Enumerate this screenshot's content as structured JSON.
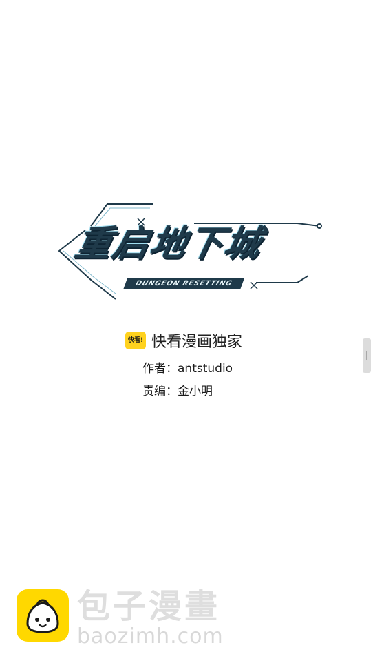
{
  "logo": {
    "title": "重启地下城",
    "subtitle": "DUNGEON RESETTING"
  },
  "exclusive": {
    "badge": "快看!",
    "text": "快看漫画独家"
  },
  "credits": {
    "author": "作者：antstudio",
    "editor": "责编：金小明"
  },
  "watermark": {
    "icon": "baozi-mascot-icon",
    "name": "包子漫畫",
    "url": "baozimh.com"
  },
  "colors": {
    "background": "#ffffff",
    "logo_dark": "#1f3a4a",
    "logo_accent": "#9fdcee",
    "badge_yellow": "#ffd21f",
    "watermark_yellow": "#ffd800",
    "watermark_text": "#dedede"
  }
}
